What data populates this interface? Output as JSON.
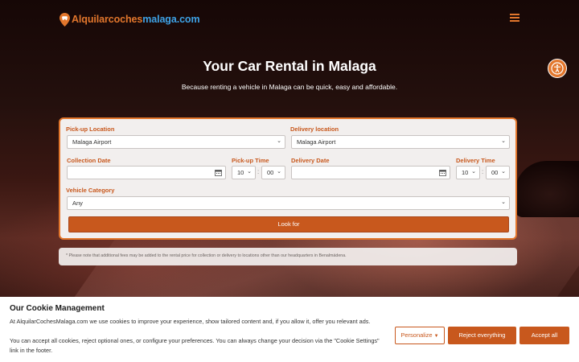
{
  "header": {
    "logo_part1": "Alquilarcoches",
    "logo_part2": "malaga.com",
    "menu_icon": "hamburger-menu-icon"
  },
  "hero": {
    "title": "Your Car Rental in Malaga",
    "subtitle": "Because renting a vehicle in Malaga can be quick, easy and affordable."
  },
  "form": {
    "pickup_location_label": "Pick-up Location",
    "pickup_location_value": "Malaga Airport",
    "delivery_location_label": "Delivery location",
    "delivery_location_value": "Malaga Airport",
    "collection_date_label": "Collection Date",
    "collection_date_value": "",
    "pickup_time_label": "Pick-up Time",
    "pickup_hour": "10",
    "pickup_minute": "00",
    "delivery_date_label": "Delivery Date",
    "delivery_date_value": "",
    "delivery_time_label": "Delivery Time",
    "delivery_hour": "10",
    "delivery_minute": "00",
    "time_separator": ":",
    "vehicle_category_label": "Vehicle Category",
    "vehicle_category_value": "Any",
    "submit_label": "Look for"
  },
  "note": "* Please note that additional fees may be added to the rental price for collection or delivery to locations other than our headquarters in Benalmádena.",
  "cookie": {
    "title": "Our Cookie Management",
    "text1": "At AlquilarCochesMalaga.com we use cookies to improve your experience, show tailored content and, if you allow it, offer you relevant ads.",
    "text2": "You can accept all cookies, reject optional ones, or configure your preferences. You can always change your decision via the \"Cookie Settings\" link in the footer.",
    "personalize_label": "Personalize",
    "reject_label": "Reject everything",
    "accept_label": "Accept all"
  },
  "colors": {
    "accent": "#c8581d",
    "logo_orange": "#e2762c",
    "logo_blue": "#3ea2e6"
  },
  "icons": {
    "accessibility": "accessibility-icon",
    "calendar": "calendar-icon",
    "select": "chevron-down-icon"
  }
}
